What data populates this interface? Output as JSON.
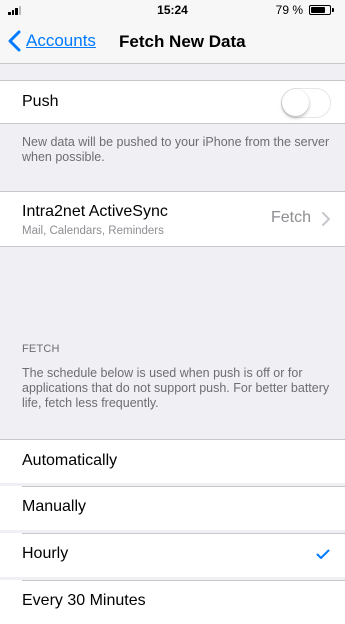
{
  "status_bar": {
    "time": "15:24",
    "battery_pct": "79 %",
    "battery_level": 0.79
  },
  "nav": {
    "back_label": "Accounts",
    "title": "Fetch New Data"
  },
  "push": {
    "label": "Push",
    "enabled": false,
    "footer": "New data will be pushed to your iPhone from the server when possible."
  },
  "account": {
    "name": "Intra2net ActiveSync",
    "subtitle": "Mail, Calendars, Reminders",
    "value": "Fetch"
  },
  "fetch": {
    "header": "FETCH",
    "description": "The schedule below is used when push is off or for applications that do not support push. For better battery life, fetch less frequently.",
    "options": [
      {
        "label": "Automatically",
        "selected": false
      },
      {
        "label": "Manually",
        "selected": false
      },
      {
        "label": "Hourly",
        "selected": true
      },
      {
        "label": "Every 30 Minutes",
        "selected": false
      }
    ]
  },
  "colors": {
    "accent": "#007aff",
    "background": "#efeff4"
  }
}
